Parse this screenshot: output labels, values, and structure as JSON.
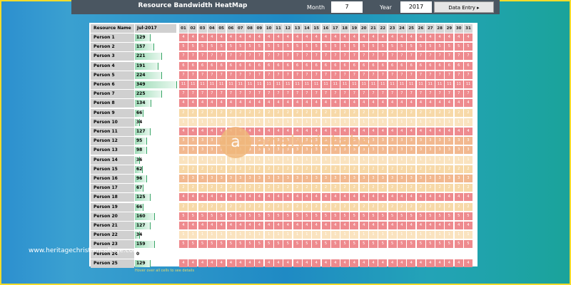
{
  "header": {
    "title": "Resource Bandwidth HeatMap",
    "month_label": "Month",
    "month_value": "7",
    "year_label": "Year",
    "year_value": "2017",
    "data_entry_label": "Data Entry ▸"
  },
  "table": {
    "col_name_header": "Resource Name",
    "col_month_header": "Jul-2017",
    "days": [
      "01",
      "02",
      "03",
      "04",
      "05",
      "06",
      "07",
      "08",
      "09",
      "10",
      "11",
      "12",
      "13",
      "14",
      "15",
      "16",
      "17",
      "18",
      "19",
      "20",
      "21",
      "22",
      "23",
      "24",
      "25",
      "26",
      "27",
      "28",
      "29",
      "30",
      "31"
    ],
    "rows": [
      {
        "name": "Person 1",
        "total": "129",
        "fraction": 0.37,
        "daily": "4"
      },
      {
        "name": "Person 2",
        "total": "157",
        "fraction": 0.45,
        "daily": "5"
      },
      {
        "name": "Person 3",
        "total": "221",
        "fraction": 0.63,
        "daily": "7"
      },
      {
        "name": "Person 4",
        "total": "191",
        "fraction": 0.55,
        "daily": "6"
      },
      {
        "name": "Person 5",
        "total": "224",
        "fraction": 0.64,
        "daily": "7"
      },
      {
        "name": "Person 6",
        "total": "349",
        "fraction": 1.0,
        "daily": "11"
      },
      {
        "name": "Person 7",
        "total": "225",
        "fraction": 0.64,
        "daily": "7"
      },
      {
        "name": "Person 8",
        "total": "134",
        "fraction": 0.38,
        "daily": "4"
      },
      {
        "name": "Person 9",
        "total": "66",
        "fraction": 0.19,
        "daily": "2"
      },
      {
        "name": "Person 10",
        "total": "34",
        "fraction": 0.1,
        "daily": "1"
      },
      {
        "name": "Person 11",
        "total": "127",
        "fraction": 0.36,
        "daily": "4"
      },
      {
        "name": "Person 12",
        "total": "95",
        "fraction": 0.27,
        "daily": "3"
      },
      {
        "name": "Person 13",
        "total": "98",
        "fraction": 0.28,
        "daily": "3"
      },
      {
        "name": "Person 14",
        "total": "36",
        "fraction": 0.1,
        "daily": "1"
      },
      {
        "name": "Person 15",
        "total": "62",
        "fraction": 0.18,
        "daily": "2"
      },
      {
        "name": "Person 16",
        "total": "96",
        "fraction": 0.28,
        "daily": "3"
      },
      {
        "name": "Person 17",
        "total": "67",
        "fraction": 0.19,
        "daily": "2"
      },
      {
        "name": "Person 18",
        "total": "125",
        "fraction": 0.36,
        "daily": "4"
      },
      {
        "name": "Person 19",
        "total": "66",
        "fraction": 0.19,
        "daily": "2"
      },
      {
        "name": "Person 20",
        "total": "160",
        "fraction": 0.46,
        "daily": "5"
      },
      {
        "name": "Person 21",
        "total": "127",
        "fraction": 0.36,
        "daily": "4"
      },
      {
        "name": "Person 22",
        "total": "34",
        "fraction": 0.1,
        "daily": "1"
      },
      {
        "name": "Person 23",
        "total": "159",
        "fraction": 0.46,
        "daily": "5"
      },
      {
        "name": "Person 24",
        "total": "0",
        "fraction": 0.0,
        "daily": ""
      },
      {
        "name": "Person 25",
        "total": "129",
        "fraction": 0.37,
        "daily": "4"
      }
    ]
  },
  "colors": {
    "high": "#ee8a8e",
    "mid": "#f2b88f",
    "low": "#f7d9a8",
    "lowest": "#fae3bf"
  },
  "watermark": {
    "text": "analysistabs",
    "logo": "a"
  },
  "footnote": "Hover over all cells to see details",
  "credit": "www.heritagechristiancollege.com"
}
